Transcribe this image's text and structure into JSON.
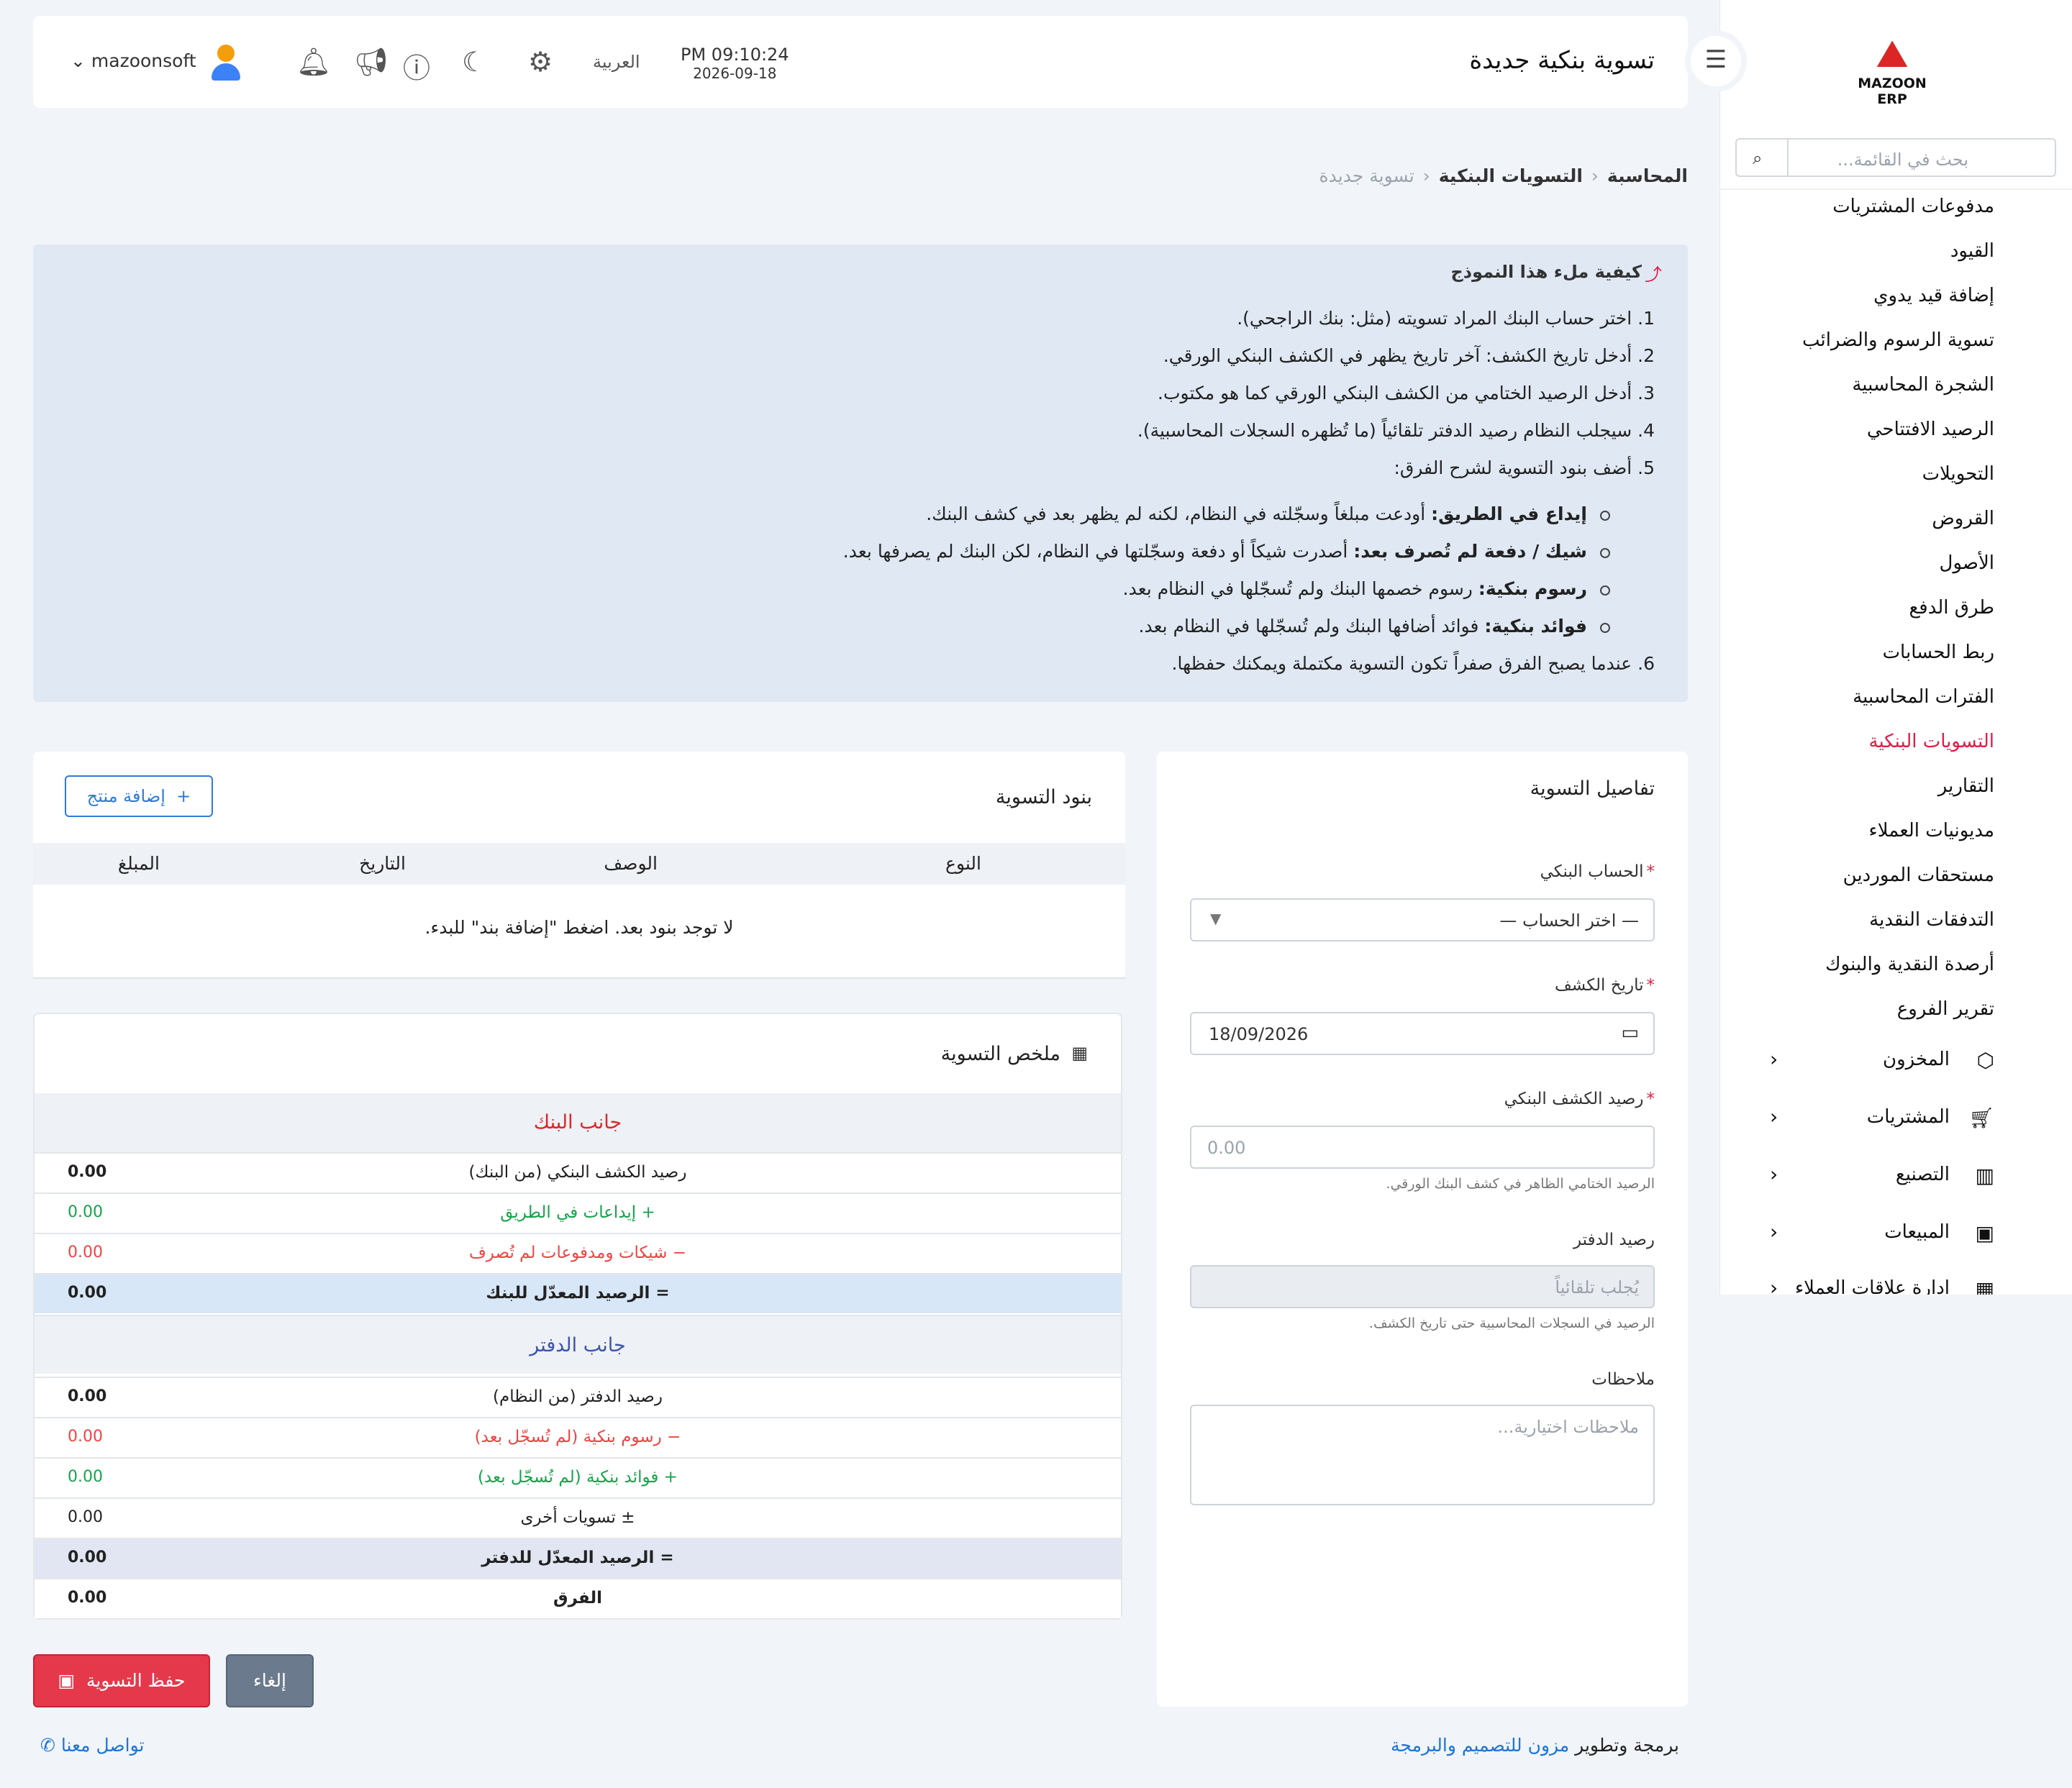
{
  "brand": {
    "name": "MAZOON ERP",
    "colors": {
      "accent": "#e11d48",
      "link": "#1d74d8",
      "primary": "#2f7bd8"
    }
  },
  "header": {
    "title": "تسوية بنكية جديدة",
    "time": "PM 09:10:24",
    "date": "2026-09-18",
    "language": "العربية",
    "user": "mazoonsoft",
    "icons": [
      "settings-icon",
      "moon-icon",
      "help-icon",
      "megaphone-icon",
      "bell-icon"
    ]
  },
  "sidebar": {
    "search_placeholder": "بحث في القائمة...",
    "items": [
      {
        "label": "مدفوعات المشتريات"
      },
      {
        "label": "القيود"
      },
      {
        "label": "إضافة قيد يدوي"
      },
      {
        "label": "تسوية الرسوم والضرائب"
      },
      {
        "label": "الشجرة المحاسبية"
      },
      {
        "label": "الرصيد الافتتاحي"
      },
      {
        "label": "التحويلات"
      },
      {
        "label": "القروض"
      },
      {
        "label": "الأصول"
      },
      {
        "label": "طرق الدفع"
      },
      {
        "label": "ربط الحسابات"
      },
      {
        "label": "الفترات المحاسبية"
      },
      {
        "label": "التسويات البنكية",
        "active": true
      },
      {
        "label": "التقارير"
      },
      {
        "label": "مديونيات العملاء"
      },
      {
        "label": "مستحقات الموردين"
      },
      {
        "label": "التدفقات النقدية"
      },
      {
        "label": "أرصدة النقدية والبنوك"
      },
      {
        "label": "تقرير الفروع"
      }
    ],
    "groups": [
      {
        "label": "المخزون",
        "icon": "box-icon"
      },
      {
        "label": "المشتريات",
        "icon": "cart-icon"
      },
      {
        "label": "التصنيع",
        "icon": "factory-icon"
      },
      {
        "label": "المبيعات",
        "icon": "cash-icon"
      },
      {
        "label": "ادارة علاقات العملاء",
        "icon": "building-icon"
      }
    ]
  },
  "breadcrumb": {
    "items": [
      "المحاسبة",
      "التسويات البنكية",
      "تسوية جديدة"
    ]
  },
  "help": {
    "title": "كيفية ملء هذا النموذج",
    "steps": [
      "1. اختر حساب البنك المراد تسويته (مثل: بنك الراجحي).",
      "2. أدخل تاريخ الكشف: آخر تاريخ يظهر في الكشف البنكي الورقي.",
      "3. أدخل الرصيد الختامي من الكشف البنكي الورقي كما هو مكتوب.",
      "4. سيجلب النظام رصيد الدفتر تلقائياً (ما تُظهره السجلات المحاسبية).",
      "5. أضف بنود التسوية لشرح الفرق:"
    ],
    "sub": [
      {
        "term": "إيداع في الطريق:",
        "text": " أودعت مبلغاً وسجّلته في النظام، لكنه لم يظهر بعد في كشف البنك."
      },
      {
        "term": "شيك / دفعة لم تُصرف بعد:",
        "text": " أصدرت شيكاً أو دفعة وسجّلتها في النظام، لكن البنك لم يصرفها بعد."
      },
      {
        "term": "رسوم بنكية:",
        "text": " رسوم خصمها البنك ولم تُسجّلها في النظام بعد."
      },
      {
        "term": "فوائد بنكية:",
        "text": " فوائد أضافها البنك ولم تُسجّلها في النظام بعد."
      }
    ],
    "last": "6. عندما يصبح الفرق صفراً تكون التسوية مكتملة ويمكنك حفظها."
  },
  "details": {
    "title": "تفاصيل التسوية",
    "bank_label": "الحساب البنكي",
    "bank_value": "— اختر الحساب —",
    "date_label": "تاريخ الكشف",
    "date_value": "18/09/2026",
    "balance_label": "رصيد الكشف البنكي",
    "balance_placeholder": "0.00",
    "balance_hint": "الرصيد الختامي الظاهر في كشف البنك الورقي.",
    "book_label": "رصيد الدفتر",
    "book_placeholder": "يُجلب تلقائياً",
    "book_hint": "الرصيد في السجلات المحاسبية حتى تاريخ الكشف.",
    "notes_label": "ملاحظات",
    "notes_placeholder": "ملاحظات اختيارية..."
  },
  "items": {
    "title": "بنود التسوية",
    "add_label": "إضافة منتج",
    "columns": [
      "النوع",
      "الوصف",
      "التاريخ",
      "المبلغ"
    ],
    "empty": "لا توجد بنود بعد. اضغط \"إضافة بند\" للبدء."
  },
  "summary": {
    "title": "ملخص التسوية",
    "bank_side": "جانب البنك",
    "book_side": "جانب الدفتر",
    "bank_rows": [
      {
        "label": "رصيد الكشف البنكي (من البنك)",
        "value": "0.00"
      },
      {
        "label": "+ إيداعات في الطريق",
        "value": "0.00"
      },
      {
        "label": "− شيكات ومدفوعات لم تُصرف",
        "value": "0.00"
      },
      {
        "label": "= الرصيد المعدّل للبنك",
        "value": "0.00"
      }
    ],
    "book_rows": [
      {
        "label": "رصيد الدفتر (من النظام)",
        "value": "0.00"
      },
      {
        "label": "− رسوم بنكية (لم تُسجّل بعد)",
        "value": "0.00"
      },
      {
        "label": "+ فوائد بنكية (لم تُسجّل بعد)",
        "value": "0.00"
      },
      {
        "label": "± تسويات أخرى",
        "value": "0.00"
      },
      {
        "label": "= الرصيد المعدّل للدفتر",
        "value": "0.00"
      },
      {
        "label": "الفرق",
        "value": "0.00"
      }
    ]
  },
  "actions": {
    "save": "حفظ التسوية",
    "cancel": "إلغاء"
  },
  "footer": {
    "prefix": "برمجة وتطوير ",
    "link": "مزون للتصميم والبرمجة",
    "contact": "تواصل معنا"
  }
}
